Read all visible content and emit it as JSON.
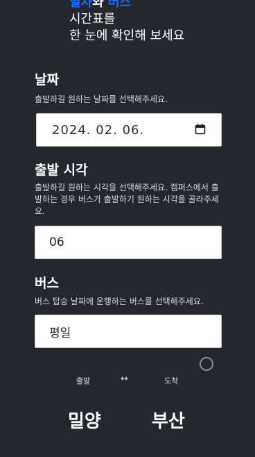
{
  "hero": {
    "line1_part_a": "열차",
    "line1_join": "와 ",
    "line1_part_b": "버스",
    "line2": "시간표를",
    "line3": "한 눈에 확인해 보세요"
  },
  "date_section": {
    "title": "날짜",
    "description": "출발하길 원하는 날짜를 선택해주세요.",
    "value": "2024. 02. 06."
  },
  "time_section": {
    "title": "출발 시각",
    "description": "출발하길 원하는 시각을 선택해주세요. 캠퍼스에서 출발하는 경우 버스가 출발하기 원하는 시각을 골라주세요.",
    "value": "06"
  },
  "bus_section": {
    "title": "버스",
    "description": "버스 탑승 날짜에 운행하는 버스를 선택해주세요.",
    "value": "평일"
  },
  "route": {
    "depart_label": "출발",
    "swap_symbol": "↔",
    "arrive_label": "도착",
    "origin": "밀양",
    "destination": "부산"
  },
  "colors": {
    "background": "#26262e",
    "accent": "#1f6bff",
    "field": "#ffffff"
  }
}
